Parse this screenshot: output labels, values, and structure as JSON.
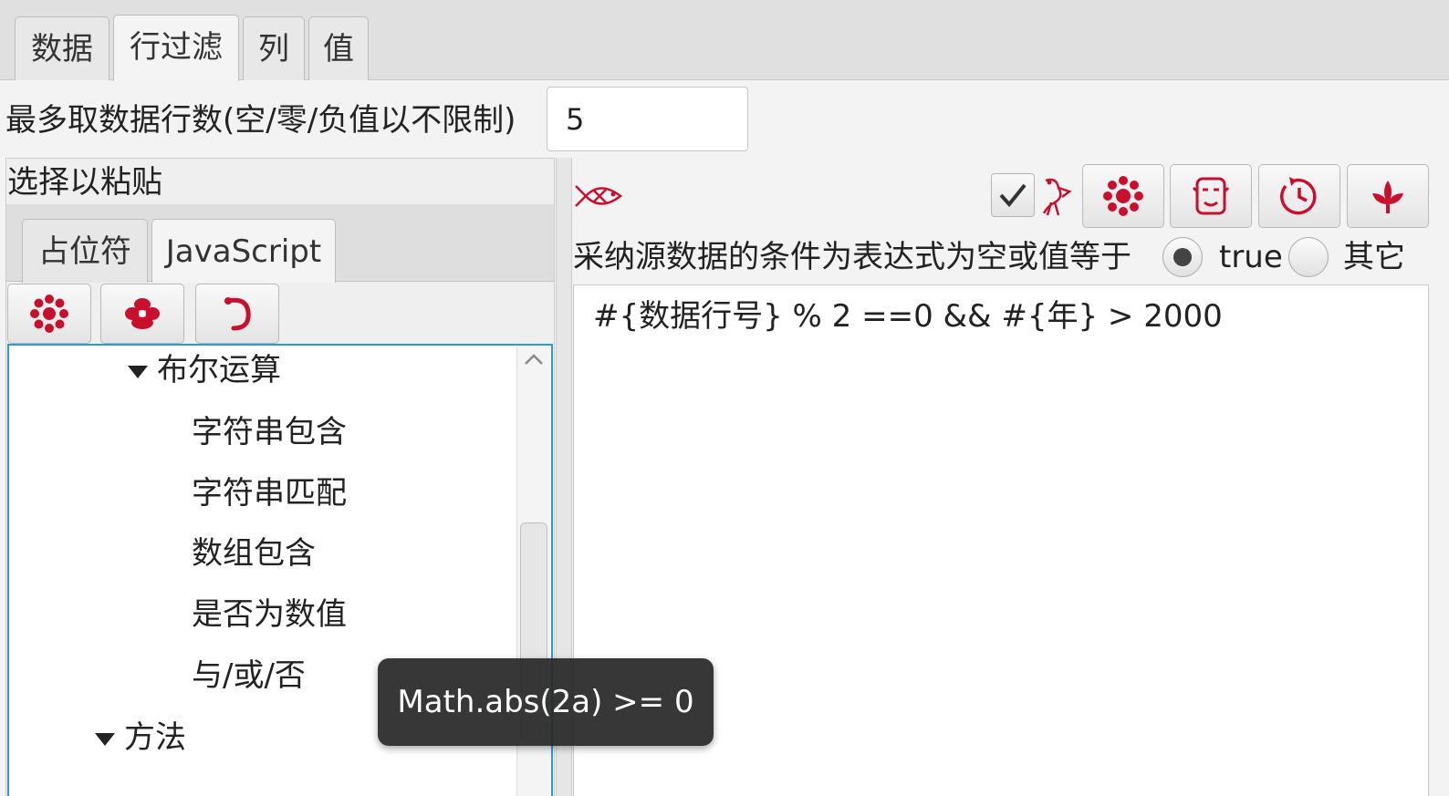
{
  "main_tabs": [
    {
      "label": "数据"
    },
    {
      "label": "行过滤",
      "active": true
    },
    {
      "label": "列"
    },
    {
      "label": "值"
    }
  ],
  "limit": {
    "label": "最多取数据行数(空/零/负值以不限制)",
    "value": "5"
  },
  "left_panel": {
    "header": "选择以粘贴",
    "tabs": [
      {
        "label": "占位符"
      },
      {
        "label": "JavaScript",
        "active": true
      }
    ],
    "toolbar_icons": [
      "flower-icon",
      "peony-icon",
      "dragon-icon"
    ],
    "tree": {
      "items": [
        {
          "label": "布尔运算",
          "expanded": true
        },
        {
          "label": "字符串包含"
        },
        {
          "label": "字符串匹配"
        },
        {
          "label": "数组包含"
        },
        {
          "label": "是否为数值"
        },
        {
          "label": "与/或/否"
        },
        {
          "label": "方法",
          "expanded": true
        }
      ]
    }
  },
  "right_panel": {
    "toolbar_icons": [
      "fish-icon",
      "bird-icon",
      "flower-icon",
      "mask-icon",
      "clock-icon",
      "lotus-icon"
    ],
    "checked": true,
    "condition_label": "采纳源数据的条件为表达式为空或值等于",
    "radio_options": [
      {
        "label": "true",
        "selected": true
      },
      {
        "label": "其它",
        "selected": false
      }
    ],
    "expression": "#{数据行号} % 2 ==0 && #{年} > 2000"
  },
  "tooltip": {
    "text": "Math.abs(2a) >= 0"
  },
  "colors": {
    "accent": "#c8102e",
    "focus_border": "#2e9ad5",
    "tooltip_bg": "#2b2b2b"
  }
}
